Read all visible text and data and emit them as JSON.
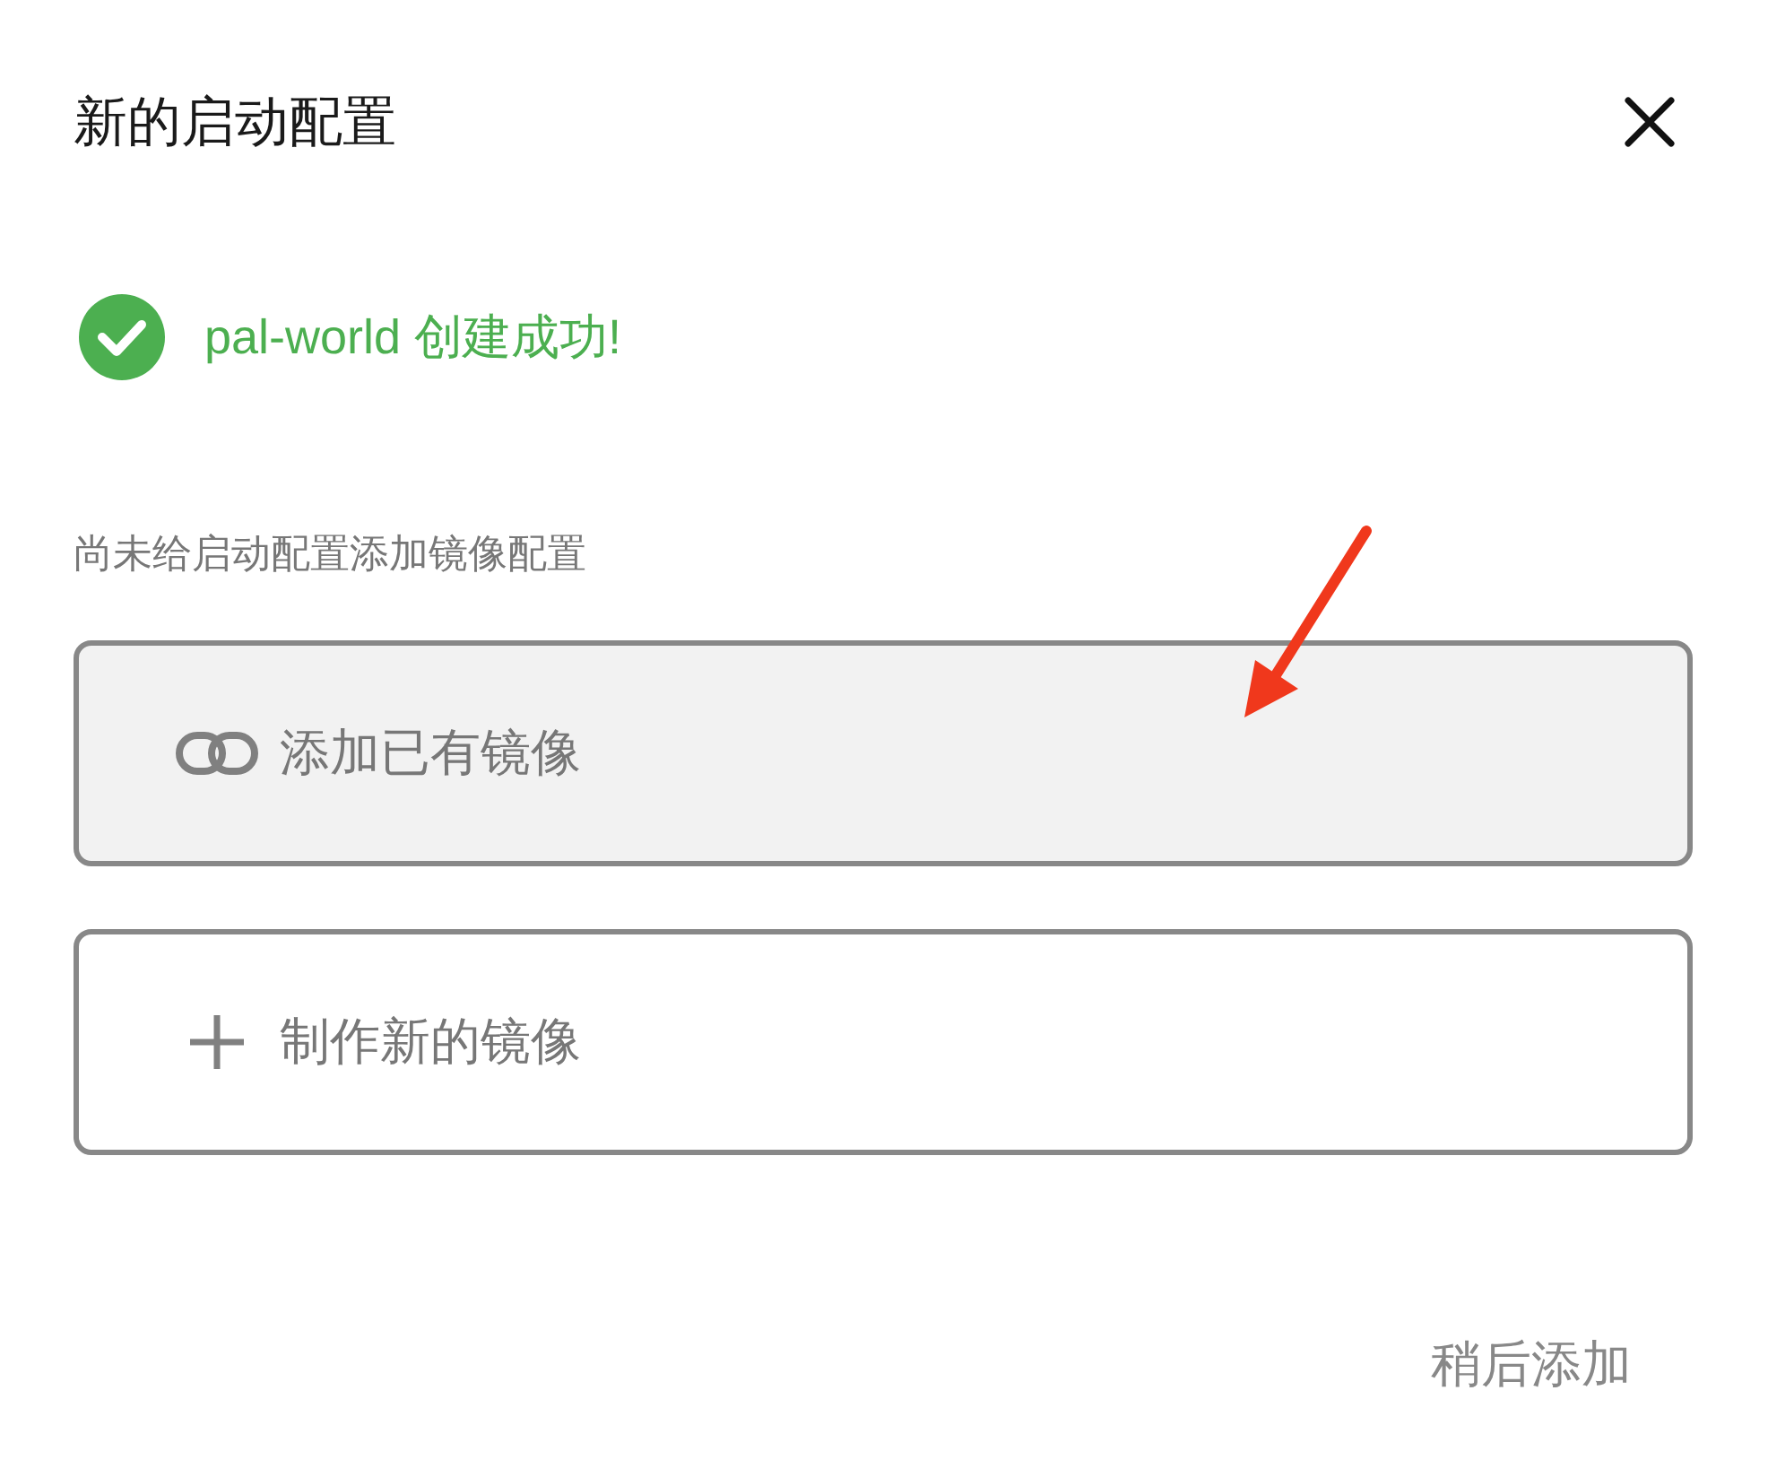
{
  "dialog": {
    "title": "新的启动配置",
    "success_message": "pal-world 创建成功!",
    "hint": "尚未给启动配置添加镜像配置",
    "options": [
      {
        "kind": "link",
        "label": "添加已有镜像",
        "selected": true
      },
      {
        "kind": "plus",
        "label": "制作新的镜像",
        "selected": false
      }
    ],
    "later_button": "稍后添加"
  }
}
